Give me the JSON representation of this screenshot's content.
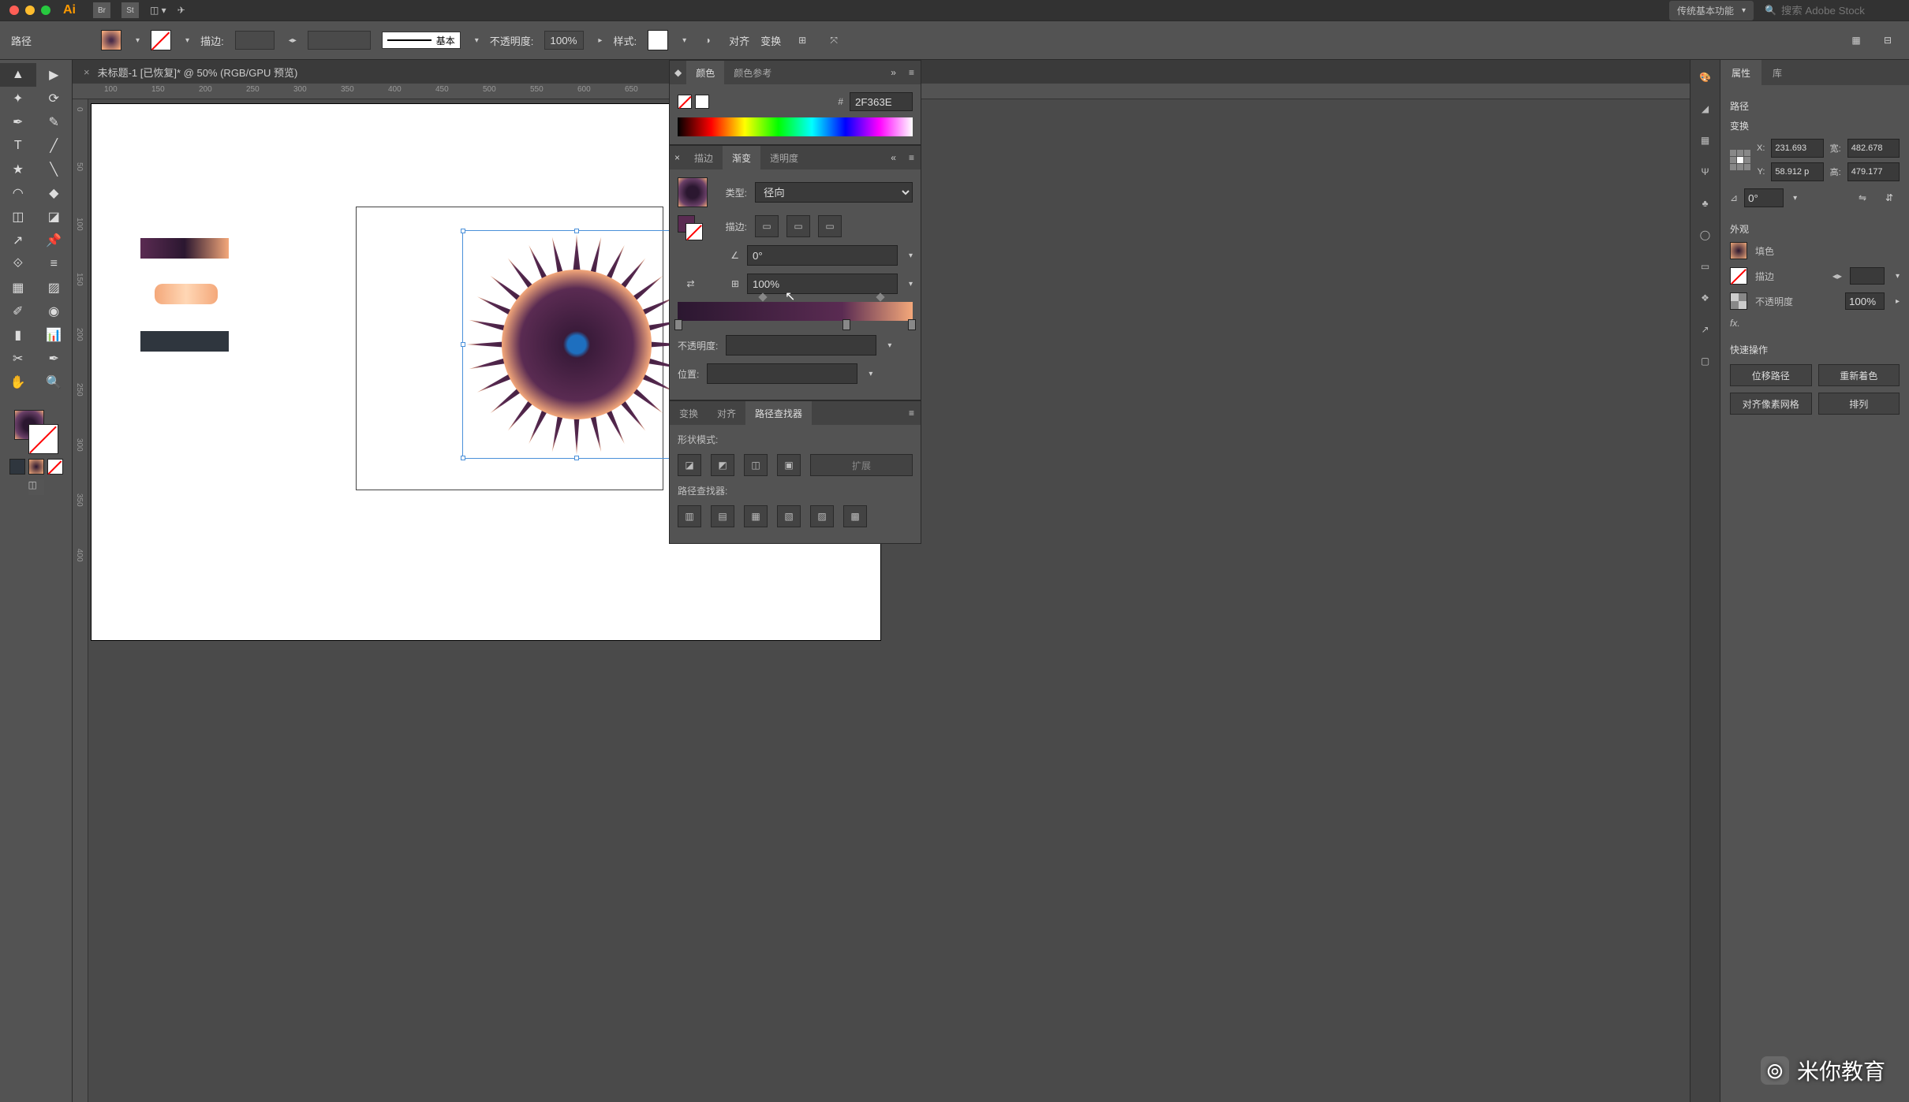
{
  "mac_app_logo": "Ai",
  "top_buttons": [
    "Br",
    "St",
    "◫ ▾",
    "✈"
  ],
  "workspace": "传统基本功能",
  "search_placeholder": "搜索 Adobe Stock",
  "control": {
    "selection": "路径",
    "stroke_label": "描边:",
    "brush_label": "基本",
    "opacity_label": "不透明度:",
    "opacity_val": "100%",
    "style_label": "样式:",
    "align_label": "对齐",
    "transform_label": "变换"
  },
  "doc_tab": "未标题-1 [已恢复]* @ 50% (RGB/GPU 预览)",
  "ruler_h": [
    "100",
    "150",
    "200",
    "250",
    "300",
    "350",
    "400",
    "450",
    "500",
    "550",
    "600",
    "650"
  ],
  "ruler_v": [
    "0",
    "50",
    "100",
    "150",
    "200",
    "250",
    "300",
    "350",
    "400"
  ],
  "toolbox_tools": [
    "▲",
    "▶",
    "✦",
    "⟳",
    "✒",
    "✎",
    "T",
    "╱",
    "★",
    "╲",
    "◠",
    "◆",
    "◫",
    "◪",
    "↗",
    "📌",
    "⟐",
    "≡",
    "▦",
    "▨",
    "✐",
    "◉",
    "▮",
    "📊",
    "✂",
    "✒",
    "✋",
    "🔍"
  ],
  "panels": {
    "color": {
      "tab1": "颜色",
      "tab2": "颜色参考",
      "hash": "#",
      "hex": "2F363E"
    },
    "gradient": {
      "tab_stroke": "描边",
      "tab_grad": "渐变",
      "tab_trans": "透明度",
      "type_label": "类型:",
      "type_val": "径向",
      "stroke_label": "描边:",
      "angle_label": "∠",
      "angle_val": "0°",
      "aspect_label": "⊞",
      "aspect_val": "100%",
      "opacity_label": "不透明度:",
      "position_label": "位置:"
    },
    "pathfinder": {
      "tab_trans": "变换",
      "tab_align": "对齐",
      "tab_pf": "路径查找器",
      "shape_mode": "形状模式:",
      "expand": "扩展",
      "pf_label": "路径查找器:"
    }
  },
  "props": {
    "tab_props": "属性",
    "tab_lib": "库",
    "kind": "路径",
    "sect_transform": "变换",
    "x": "231.693",
    "y": "58.912 p",
    "w": "482.678",
    "h": "479.177",
    "xl": "X:",
    "yl": "Y:",
    "wl": "宽:",
    "hl": "高:",
    "rot_label": "⊿",
    "rot_val": "0°",
    "sect_appear": "外观",
    "fill_label": "填色",
    "stroke_label": "描边",
    "opacity_label": "不透明度",
    "opacity_val": "100%",
    "fx": "fx.",
    "sect_quick": "快速操作",
    "qa1": "位移路径",
    "qa2": "重新着色",
    "qa3": "对齐像素网格",
    "qa4": "排列"
  },
  "watermark": "米你教育"
}
